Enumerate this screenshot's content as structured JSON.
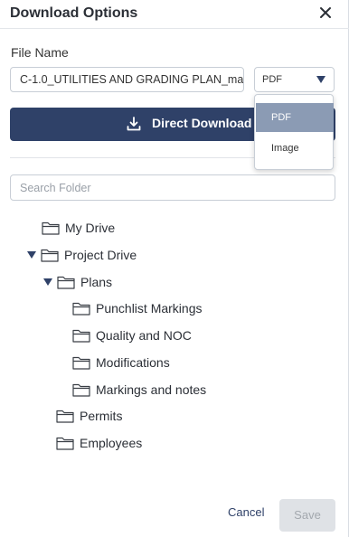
{
  "header": {
    "title": "Download Options"
  },
  "form": {
    "file_name_label": "File Name",
    "file_name_value": "C-1.0_UTILITIES AND GRADING PLAN_ma",
    "format_selected": "PDF",
    "format_options": [
      "PDF",
      "Image"
    ],
    "direct_download_label": "Direct Download",
    "search_placeholder": "Search Folder"
  },
  "tree": [
    {
      "label": "My Drive",
      "expanded": false,
      "has_toggle": false
    },
    {
      "label": "Project Drive",
      "expanded": true,
      "has_toggle": true
    },
    {
      "label": "Plans",
      "expanded": true,
      "has_toggle": true
    },
    {
      "label": "Punchlist Markings"
    },
    {
      "label": "Quality and NOC"
    },
    {
      "label": "Modifications"
    },
    {
      "label": "Markings and notes"
    },
    {
      "label": "Permits"
    },
    {
      "label": "Employees"
    }
  ],
  "footer": {
    "cancel_label": "Cancel",
    "save_label": "Save"
  },
  "colors": {
    "primary": "#2f4168",
    "selected_option": "#8b9bb4",
    "disabled": "#dfe2e6"
  }
}
